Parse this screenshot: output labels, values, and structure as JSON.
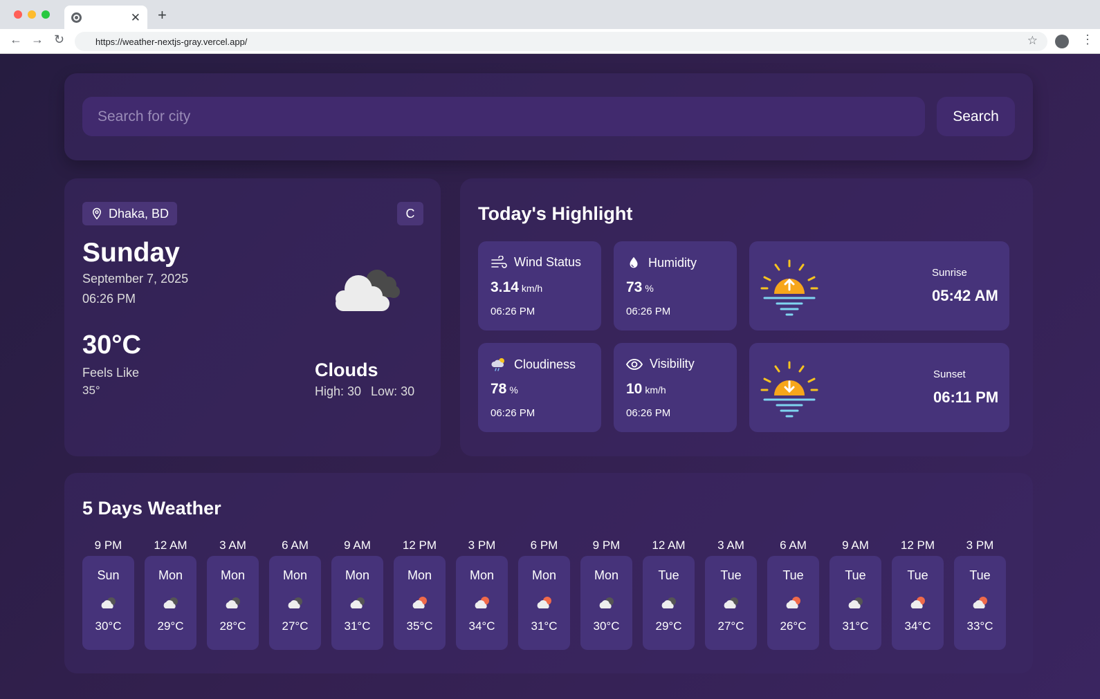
{
  "browser": {
    "url": "https://weather-nextjs-gray.vercel.app/",
    "tab_close": "✕",
    "new_tab": "+"
  },
  "search": {
    "placeholder": "Search for city",
    "button_label": "Search"
  },
  "current": {
    "location": "Dhaka, BD",
    "unit_toggle": "C",
    "day": "Sunday",
    "date": "September 7, 2025",
    "time": "06:26 PM",
    "temperature": "30°C",
    "feels_like_label": "Feels Like",
    "feels_like_value": "35°",
    "condition": "Clouds",
    "high": "High: 30",
    "low": "Low: 30",
    "icon": "cloud-icon"
  },
  "highlight": {
    "title": "Today's Highlight",
    "wind": {
      "label": "Wind Status",
      "value": "3.14",
      "unit": "km/h",
      "time": "06:26 PM",
      "icon": "wind-icon"
    },
    "humidity": {
      "label": "Humidity",
      "value": "73",
      "unit": "%",
      "time": "06:26 PM",
      "icon": "droplet-icon"
    },
    "cloudiness": {
      "label": "Cloudiness",
      "value": "78",
      "unit": "%",
      "time": "06:26 PM",
      "icon": "cloud-rain-icon"
    },
    "visibility": {
      "label": "Visibility",
      "value": "10",
      "unit": "km/h",
      "time": "06:26 PM",
      "icon": "eye-icon"
    },
    "sunrise": {
      "label": "Sunrise",
      "value": "05:42 AM",
      "icon": "sunrise-icon"
    },
    "sunset": {
      "label": "Sunset",
      "value": "06:11 PM",
      "icon": "sunset-icon"
    }
  },
  "forecast": {
    "title": "5 Days Weather",
    "items": [
      {
        "hour": "9 PM",
        "day": "Sun",
        "temp": "30°C",
        "icon": "cloud-night-icon"
      },
      {
        "hour": "12 AM",
        "day": "Mon",
        "temp": "29°C",
        "icon": "cloud-night-icon"
      },
      {
        "hour": "3 AM",
        "day": "Mon",
        "temp": "28°C",
        "icon": "cloud-night-icon"
      },
      {
        "hour": "6 AM",
        "day": "Mon",
        "temp": "27°C",
        "icon": "cloud-night-icon"
      },
      {
        "hour": "9 AM",
        "day": "Mon",
        "temp": "31°C",
        "icon": "cloud-night-icon"
      },
      {
        "hour": "12 PM",
        "day": "Mon",
        "temp": "35°C",
        "icon": "cloud-sun-icon"
      },
      {
        "hour": "3 PM",
        "day": "Mon",
        "temp": "34°C",
        "icon": "cloud-sun-icon"
      },
      {
        "hour": "6 PM",
        "day": "Mon",
        "temp": "31°C",
        "icon": "cloud-sun-icon"
      },
      {
        "hour": "9 PM",
        "day": "Mon",
        "temp": "30°C",
        "icon": "cloud-night-icon"
      },
      {
        "hour": "12 AM",
        "day": "Tue",
        "temp": "29°C",
        "icon": "cloud-night-icon"
      },
      {
        "hour": "3 AM",
        "day": "Tue",
        "temp": "27°C",
        "icon": "cloud-night-icon"
      },
      {
        "hour": "6 AM",
        "day": "Tue",
        "temp": "26°C",
        "icon": "cloud-sun-icon"
      },
      {
        "hour": "9 AM",
        "day": "Tue",
        "temp": "31°C",
        "icon": "cloud-night-icon"
      },
      {
        "hour": "12 PM",
        "day": "Tue",
        "temp": "34°C",
        "icon": "cloud-sun-icon"
      },
      {
        "hour": "3 PM",
        "day": "Tue",
        "temp": "33°C",
        "icon": "cloud-sun-icon"
      }
    ]
  }
}
